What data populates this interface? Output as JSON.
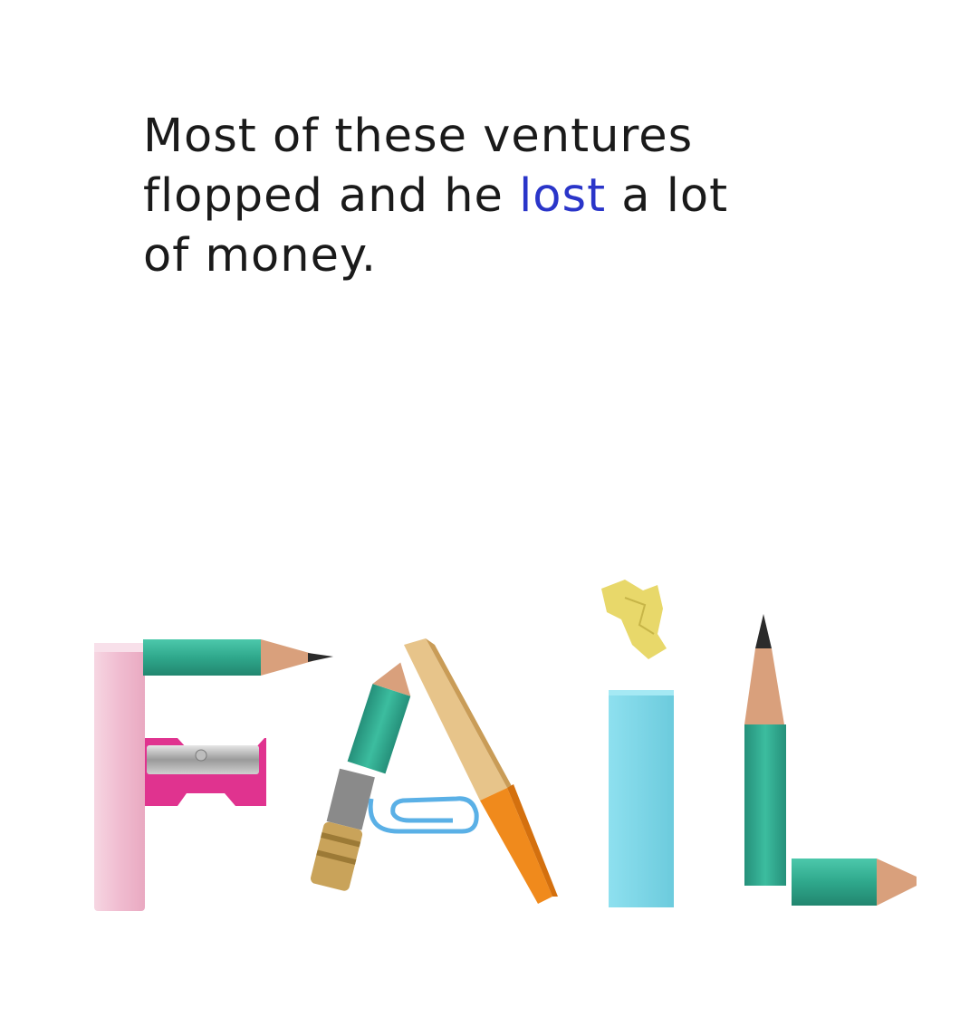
{
  "caption": {
    "line1": "Most of these ventures",
    "line2_pre": "flopped and he",
    "line2_highlight": "lost",
    "line2_post": "a lot",
    "line3": "of money."
  },
  "colors": {
    "text": "#1a1a1a",
    "accent": "#2a35c9",
    "pencil_green": "#36b59a",
    "chalk_pink": "#f2c6d6",
    "sharpener_magenta": "#e0338f",
    "eraser_blue": "#7fd6e6",
    "paperclip_blue": "#5ab0e6",
    "paper_yellow": "#e8d86a",
    "pencil_orange": "#f08a1c"
  },
  "illustration": {
    "word": "FAIL",
    "objects": [
      "pink-chalk",
      "green-pencil",
      "pencil-sharpener",
      "broken-pencil",
      "paper-clip",
      "orange-pencil",
      "crumpled-paper",
      "eraser",
      "green-pencil-vertical",
      "pencil-stub"
    ]
  }
}
